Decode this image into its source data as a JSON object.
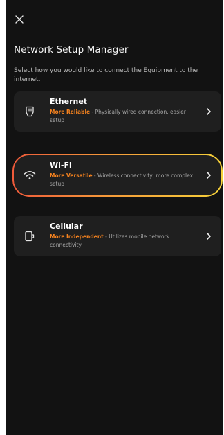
{
  "header": {
    "title": "Network Setup Manager",
    "subtitle": "Select how you would like to connect the Equipment to the internet."
  },
  "options": [
    {
      "title": "Ethernet",
      "highlight": "More Reliable",
      "description": " - Physically wired connection, easier setup",
      "icon": "ethernet-port-icon",
      "selected": false
    },
    {
      "title": "Wi-Fi",
      "highlight": "More Versatile",
      "description": " - Wireless connectivity, more complex setup",
      "icon": "wifi-icon",
      "selected": true
    },
    {
      "title": "Cellular",
      "highlight": "More Independent",
      "description": " - Utilizes mobile network connectivity",
      "icon": "cellular-device-icon",
      "selected": false
    }
  ],
  "colors": {
    "background": "#121212",
    "card": "#1f1f1f",
    "accent": "#f5821f",
    "gradient_start": "#ef5a3a",
    "gradient_end": "#f6d23a"
  }
}
